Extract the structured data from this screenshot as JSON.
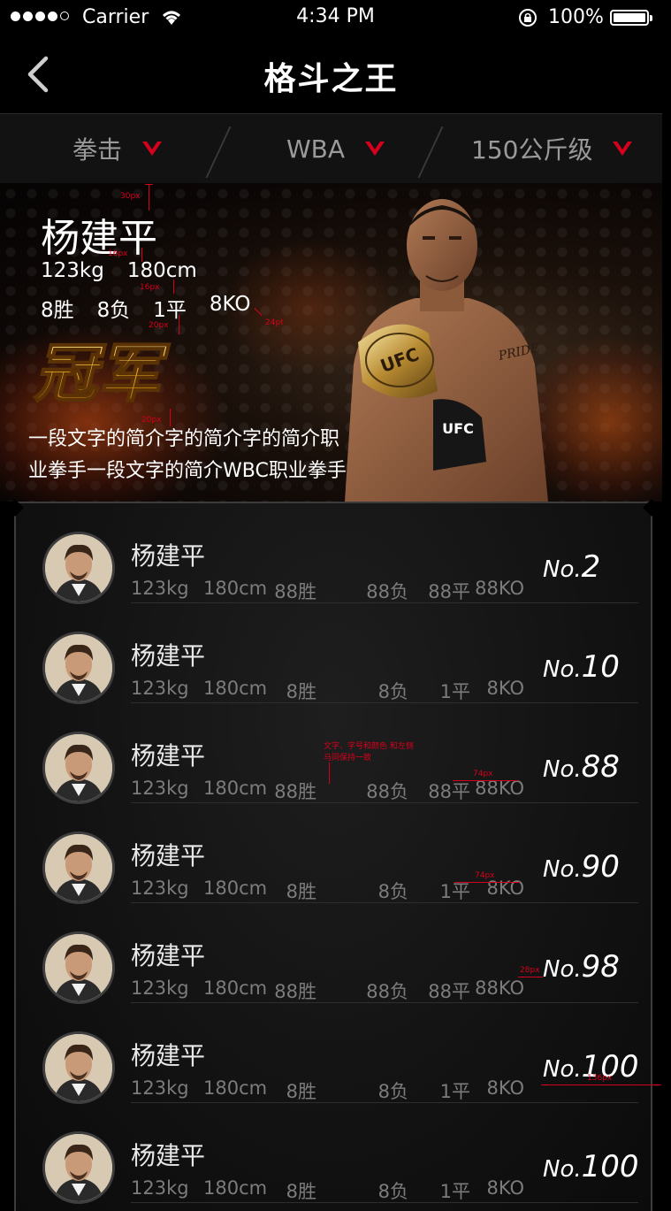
{
  "status": {
    "carrier": "Carrier",
    "time": "4:34 PM",
    "battery": "100%",
    "battery_level": 1.0
  },
  "nav": {
    "title": "格斗之王"
  },
  "filters": [
    "拳击",
    "WBA",
    "150公斤级"
  ],
  "featured": {
    "name": "杨建平",
    "weight": "123kg",
    "height": "180cm",
    "wins": "8胜",
    "losses": "8负",
    "draws": "1平",
    "ko": "8KO",
    "badge_text": "冠军",
    "description_line1": "一段文字的简介字的简介字的简介职",
    "description_line2": "业拳手一段文字的简介WBC职业拳手",
    "logo_text": "UFC"
  },
  "annotations": {
    "a30": "30px",
    "a16a": "16px",
    "a16b": "16px",
    "a20a": "20px",
    "a24": "24pt",
    "a20b": "20px",
    "note1": "文字、字号和颜色 和左侧",
    "note2": "马同保持一致",
    "a74a": "74px",
    "a74b": "74px",
    "a28": "28px",
    "a136": "136px"
  },
  "ranking": [
    {
      "name": "杨建平",
      "weight": "123kg",
      "height": "180cm",
      "wins": "88胜",
      "losses": "88负",
      "draws": "88平",
      "ko": "88KO",
      "no": "No.",
      "rank": "2"
    },
    {
      "name": "杨建平",
      "weight": "123kg",
      "height": "180cm",
      "wins": "8胜",
      "losses": "8负",
      "draws": "1平",
      "ko": "8KO",
      "no": "No.",
      "rank": "10"
    },
    {
      "name": "杨建平",
      "weight": "123kg",
      "height": "180cm",
      "wins": "88胜",
      "losses": "88负",
      "draws": "88平",
      "ko": "88KO",
      "no": "No.",
      "rank": "88"
    },
    {
      "name": "杨建平",
      "weight": "123kg",
      "height": "180cm",
      "wins": "8胜",
      "losses": "8负",
      "draws": "1平",
      "ko": "8KO",
      "no": "No.",
      "rank": "90"
    },
    {
      "name": "杨建平",
      "weight": "123kg",
      "height": "180cm",
      "wins": "88胜",
      "losses": "88负",
      "draws": "88平",
      "ko": "88KO",
      "no": "No.",
      "rank": "98"
    },
    {
      "name": "杨建平",
      "weight": "123kg",
      "height": "180cm",
      "wins": "8胜",
      "losses": "8负",
      "draws": "1平",
      "ko": "8KO",
      "no": "No.",
      "rank": "100"
    },
    {
      "name": "杨建平",
      "weight": "123kg",
      "height": "180cm",
      "wins": "8胜",
      "losses": "8负",
      "draws": "1平",
      "ko": "8KO",
      "no": "No.",
      "rank": "100"
    }
  ],
  "colors": {
    "accent": "#d6001c",
    "background": "#000000",
    "muted_text": "#7c7c7c",
    "filter_text": "#9a9a9a"
  }
}
